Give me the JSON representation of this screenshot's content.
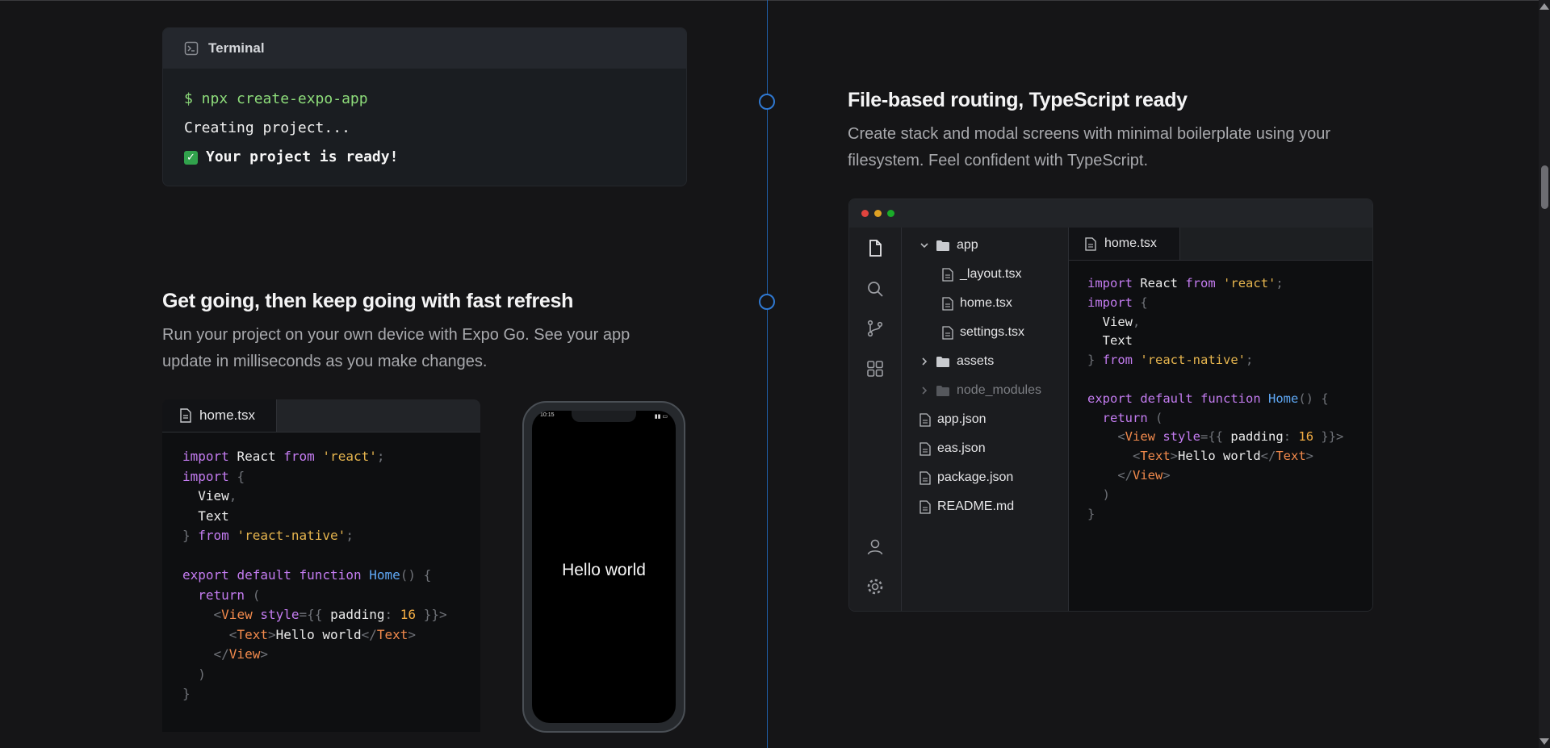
{
  "terminal": {
    "title": "Terminal",
    "prompt": "$ npx create-expo-app",
    "line2": "Creating project...",
    "line3_icon": "check-emoji",
    "line3": "Your project is ready!"
  },
  "section_left": {
    "heading": "Get going, then keep going with fast refresh",
    "description_line1": "Run your project on your own device with Expo Go. See your app",
    "description_line2": "update in milliseconds as you make changes."
  },
  "section_right": {
    "heading": "File-based routing, TypeScript ready",
    "description_line1": "Create stack and modal screens with minimal boilerplate using your",
    "description_line2": "filesystem. Feel confident with TypeScript."
  },
  "left_editor": {
    "tab_label": "home.tsx"
  },
  "phone": {
    "status_time": "10:15",
    "screen_text": "Hello world"
  },
  "ide": {
    "window_dots": [
      "#e0443e",
      "#dea123",
      "#1aab29"
    ],
    "activity_icons": [
      "files-icon",
      "search-icon",
      "source-control-icon",
      "extensions-icon",
      "account-icon",
      "settings-gear-icon"
    ],
    "explorer": {
      "app_folder": "app",
      "layout_file": "_layout.tsx",
      "home_file": "home.tsx",
      "settings_file": "settings.tsx",
      "assets_folder": "assets",
      "node_modules_folder": "node_modules",
      "app_json": "app.json",
      "eas_json": "eas.json",
      "package_json": "package.json",
      "readme": "README.md"
    },
    "tab_label": "home.tsx"
  },
  "code": {
    "import": "import",
    "react": "React",
    "from": "from",
    "react_str": "'react'",
    "view": "View",
    "text": "Text",
    "rn_str": "'react-native'",
    "export": "export",
    "default": "default",
    "function": "function",
    "home": "Home",
    "return": "return",
    "style": "style",
    "padding": "padding",
    "sixteen": "16",
    "hello": "Hello world"
  },
  "colors": {
    "background": "#151517",
    "timeline": "#2f78d1",
    "keyword": "#c47cf1",
    "string": "#e6b54e",
    "tag": "#f28a4c",
    "function_name": "#5fa8f5"
  }
}
